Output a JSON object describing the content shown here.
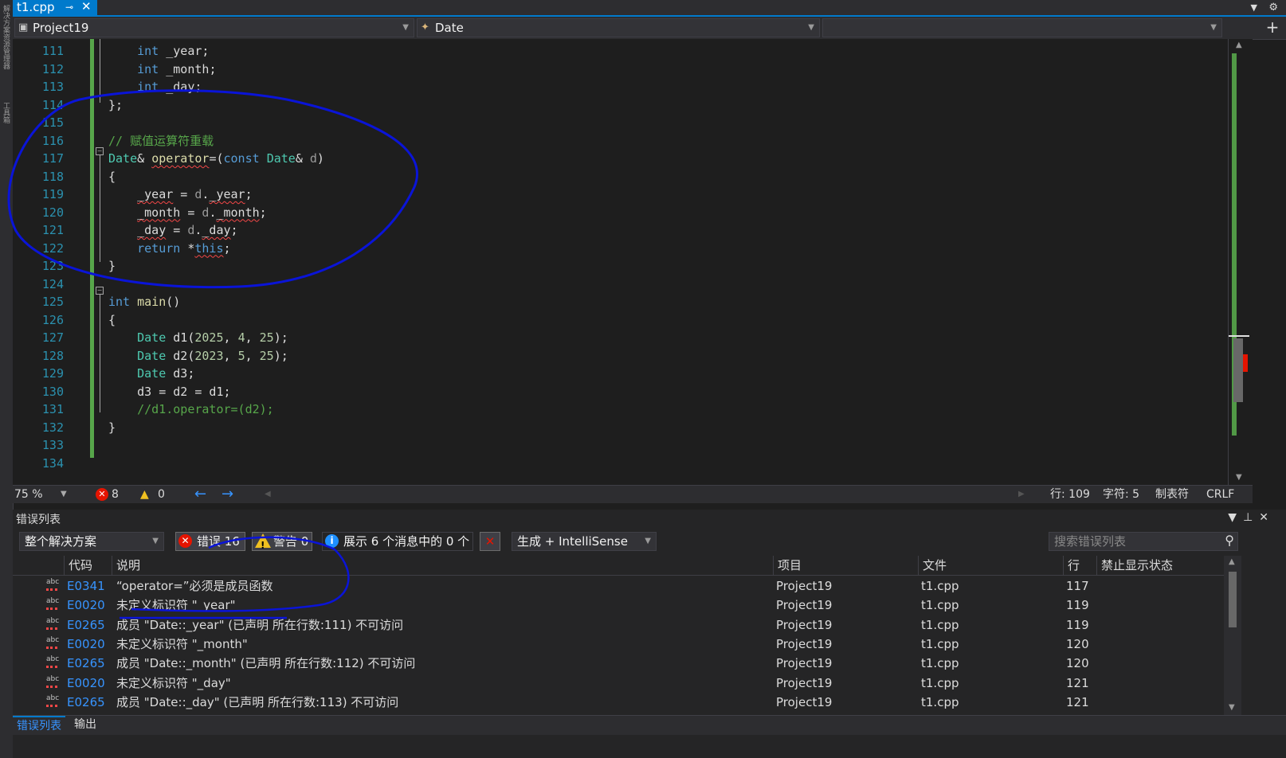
{
  "tab": {
    "filename": "t1.cpp",
    "pin_icon": "pin-icon",
    "close_icon": "close-icon"
  },
  "left_strip": {
    "labels": [
      "解决方案资源管理器",
      "工具箱"
    ]
  },
  "navbar": {
    "project": "Project19",
    "scope": "Date",
    "member": ""
  },
  "editor": {
    "lines": [
      {
        "n": "111",
        "html": "    <span class='kw'>int</span> <span class='mem'>_year</span>;"
      },
      {
        "n": "112",
        "html": "    <span class='kw'>int</span> <span class='mem'>_month</span>;"
      },
      {
        "n": "113",
        "html": "    <span class='kw'>int</span> <span class='mem'>_day</span>;"
      },
      {
        "n": "114",
        "html": "};"
      },
      {
        "n": "115",
        "html": ""
      },
      {
        "n": "116",
        "html": "<span class='cm'>// 赋值运算符重载</span>"
      },
      {
        "n": "117",
        "html": "<span class='ty'>Date</span>&amp; <span class='fn squig'>operator</span>=(<span class='kw'>const</span> <span class='ty'>Date</span>&amp; <span class='par'>d</span>)"
      },
      {
        "n": "118",
        "html": "{"
      },
      {
        "n": "119",
        "html": "    <span class='squig'>_year</span> = <span class='par'>d</span>.<span class='squig'>_year</span>;"
      },
      {
        "n": "120",
        "html": "    <span class='squig'>_month</span> = <span class='par'>d</span>.<span class='squig'>_month</span>;"
      },
      {
        "n": "121",
        "html": "    <span class='squig'>_day</span> = <span class='par'>d</span>.<span class='squig'>_day</span>;"
      },
      {
        "n": "122",
        "html": "    <span class='kw'>return</span> *<span class='kw squig'>this</span>;"
      },
      {
        "n": "123",
        "html": "}"
      },
      {
        "n": "124",
        "html": ""
      },
      {
        "n": "125",
        "html": "<span class='kw'>int</span> <span class='fn'>main</span>()"
      },
      {
        "n": "126",
        "html": "{"
      },
      {
        "n": "127",
        "html": "    <span class='ty'>Date</span> d1(<span class='num'>2025</span>, <span class='num'>4</span>, <span class='num'>25</span>);"
      },
      {
        "n": "128",
        "html": "    <span class='ty'>Date</span> d2(<span class='num'>2023</span>, <span class='num'>5</span>, <span class='num'>25</span>);"
      },
      {
        "n": "129",
        "html": "    <span class='ty'>Date</span> d3;"
      },
      {
        "n": "130",
        "html": "    d3 = d2 = d1;"
      },
      {
        "n": "131",
        "html": "    <span class='cm'>//d1.operator=(d2);</span>"
      },
      {
        "n": "132",
        "html": "}"
      },
      {
        "n": "133",
        "html": ""
      },
      {
        "n": "134",
        "html": ""
      }
    ]
  },
  "edstatus": {
    "zoom": "75 %",
    "errors": "8",
    "warnings": "0",
    "line": "行: 109",
    "col": "字符: 5",
    "tabs": "制表符",
    "eol": "CRLF"
  },
  "errorlist": {
    "title": "错误列表",
    "scope": "整个解决方案",
    "errors_btn": "错误 16",
    "warnings_btn": "警告 0",
    "messages_btn": "展示 6 个消息中的 0 个",
    "build_filter": "生成 + IntelliSense",
    "search_placeholder": "搜索错误列表",
    "columns": [
      "代码",
      "说明",
      "项目",
      "文件",
      "行",
      "禁止显示状态"
    ],
    "rows": [
      {
        "code": "E0341",
        "desc": "“operator=”必须是成员函数",
        "project": "Project19",
        "file": "t1.cpp",
        "line": "117"
      },
      {
        "code": "E0020",
        "desc": "未定义标识符 \"_year\"",
        "project": "Project19",
        "file": "t1.cpp",
        "line": "119"
      },
      {
        "code": "E0265",
        "desc": "成员 \"Date::_year\" (已声明 所在行数:111) 不可访问",
        "project": "Project19",
        "file": "t1.cpp",
        "line": "119"
      },
      {
        "code": "E0020",
        "desc": "未定义标识符 \"_month\"",
        "project": "Project19",
        "file": "t1.cpp",
        "line": "120"
      },
      {
        "code": "E0265",
        "desc": "成员 \"Date::_month\" (已声明 所在行数:112) 不可访问",
        "project": "Project19",
        "file": "t1.cpp",
        "line": "120"
      },
      {
        "code": "E0020",
        "desc": "未定义标识符 \"_day\"",
        "project": "Project19",
        "file": "t1.cpp",
        "line": "121"
      },
      {
        "code": "E0265",
        "desc": "成员 \"Date::_day\" (已声明 所在行数:113) 不可访问",
        "project": "Project19",
        "file": "t1.cpp",
        "line": "121"
      }
    ]
  },
  "bottomtabs": {
    "errorlist": "错误列表",
    "output": "输出"
  },
  "colors": {
    "accent": "#007acc",
    "annotation": "#0a14d8",
    "error": "#e51400",
    "link": "#3794ff"
  }
}
